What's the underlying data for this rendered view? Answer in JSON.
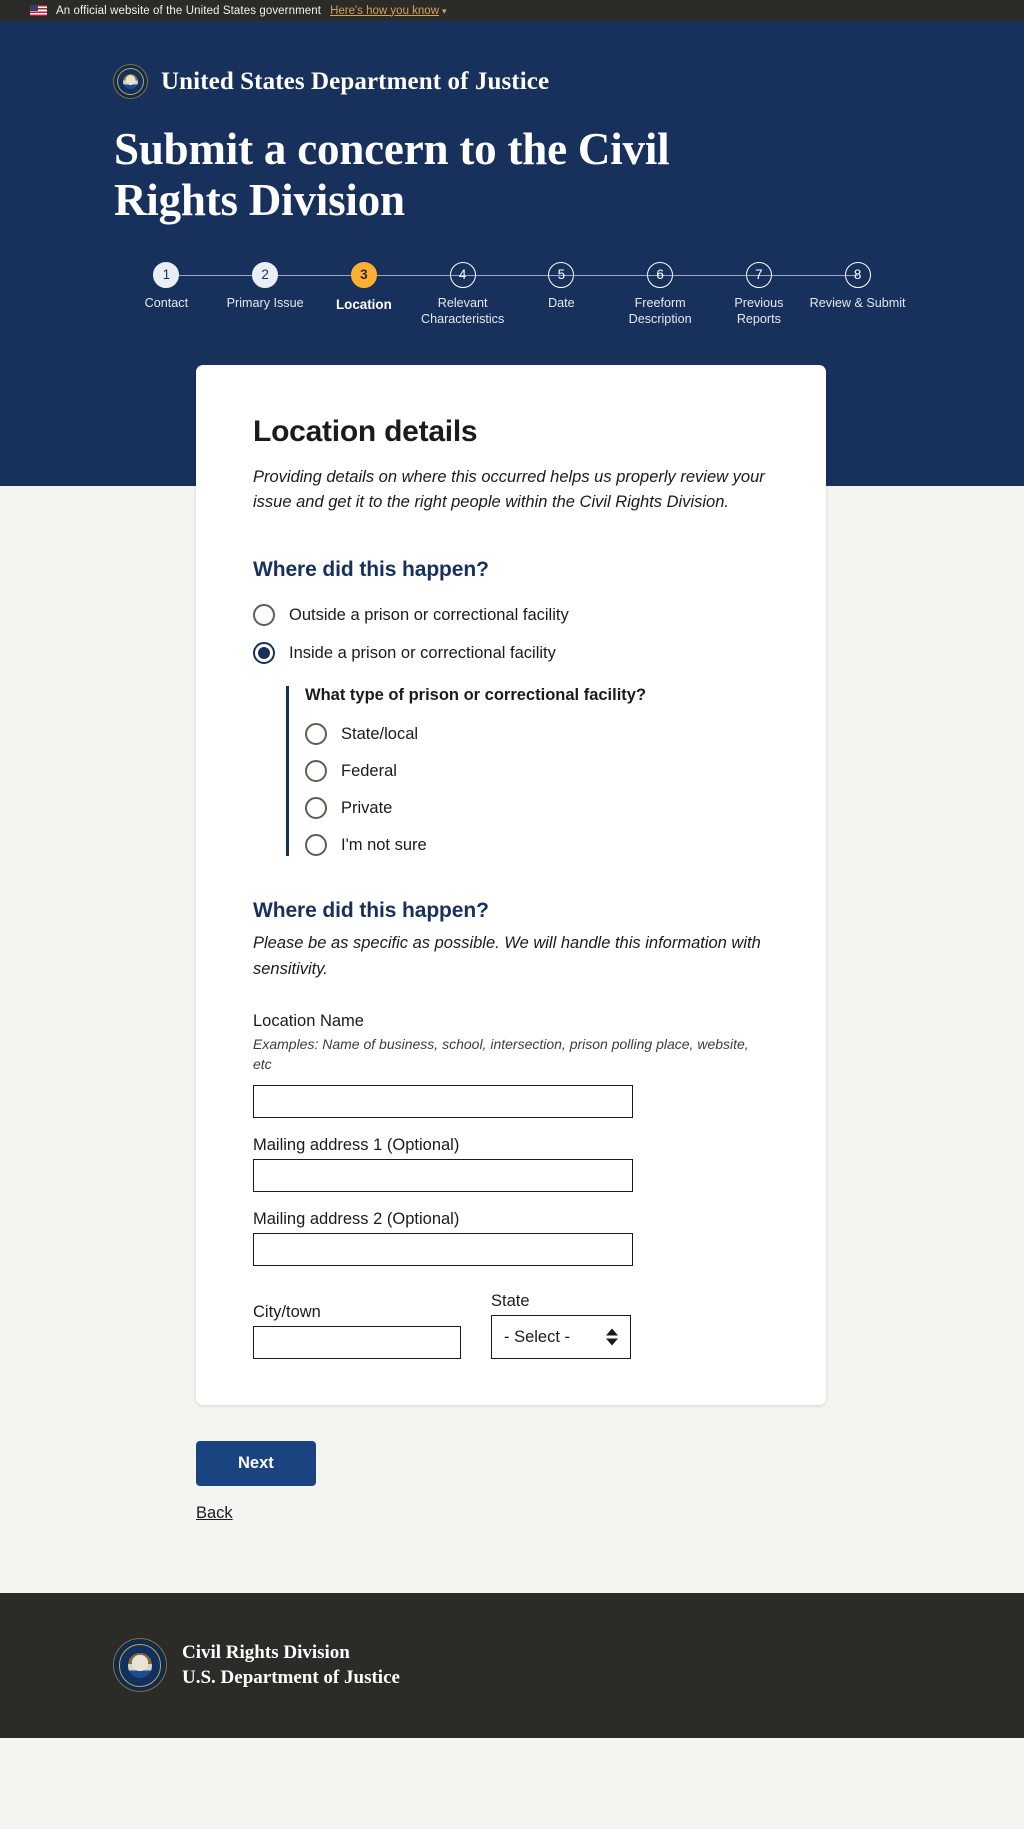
{
  "gov_banner": {
    "flag_icon": "us-flag-icon",
    "text": "An official website of the United States government",
    "link_text": "Here's how you know",
    "chevron_icon": "chevron-down-icon"
  },
  "hero": {
    "seal_icon": "doj-seal-icon",
    "agency": "United States Department of Justice",
    "title": "Submit a concern to the Civil Rights Division",
    "bg_color": "#17305c"
  },
  "stepper": {
    "current_step": 3,
    "current_color": "#fbb034",
    "steps": [
      {
        "num": "1",
        "label": "Contact",
        "state": "done"
      },
      {
        "num": "2",
        "label": "Primary Issue",
        "state": "done"
      },
      {
        "num": "3",
        "label": "Location",
        "state": "current"
      },
      {
        "num": "4",
        "label": "Relevant Characteristics",
        "state": "upcoming"
      },
      {
        "num": "5",
        "label": "Date",
        "state": "upcoming"
      },
      {
        "num": "6",
        "label": "Freeform Description",
        "state": "upcoming"
      },
      {
        "num": "7",
        "label": "Previous Reports",
        "state": "upcoming"
      },
      {
        "num": "8",
        "label": "Review & Submit",
        "state": "upcoming"
      }
    ]
  },
  "card": {
    "title": "Location details",
    "subtitle": "Providing details on where this occurred helps us properly review your issue and get it to the right people within the Civil Rights Division.",
    "where_question": {
      "heading": "Where did this happen?",
      "options": [
        {
          "label": "Outside a prison or correctional facility",
          "checked": false
        },
        {
          "label": "Inside a prison or correctional facility",
          "checked": true
        }
      ]
    },
    "facility_question": {
      "heading": "What type of prison or correctional facility?",
      "options": [
        {
          "label": "State/local",
          "checked": false
        },
        {
          "label": "Federal",
          "checked": false
        },
        {
          "label": "Private",
          "checked": false
        },
        {
          "label": "I'm not sure",
          "checked": false
        }
      ]
    },
    "address_section": {
      "heading": "Where did this happen?",
      "note": "Please be as specific as possible. We will handle this information with sensitivity.",
      "location_name": {
        "label": "Location Name",
        "hint": "Examples: Name of business, school, intersection, prison polling place, website, etc",
        "value": "",
        "placeholder": ""
      },
      "address1": {
        "label": "Mailing address 1 (Optional)",
        "value": "",
        "placeholder": ""
      },
      "address2": {
        "label": "Mailing address 2 (Optional)",
        "value": "",
        "placeholder": ""
      },
      "city": {
        "label": "City/town",
        "value": "",
        "placeholder": ""
      },
      "state": {
        "label": "State",
        "selected": "- Select -",
        "options": [
          "- Select -"
        ],
        "arrows_icon": "select-arrows-icon"
      }
    }
  },
  "actions": {
    "next_label": "Next",
    "back_label": "Back",
    "next_color": "#1a4480"
  },
  "footer": {
    "seal_icon": "doj-seal-icon",
    "line1": "Civil Rights Division",
    "line2": "U.S. Department of Justice",
    "bg_color": "#2b2b28"
  }
}
